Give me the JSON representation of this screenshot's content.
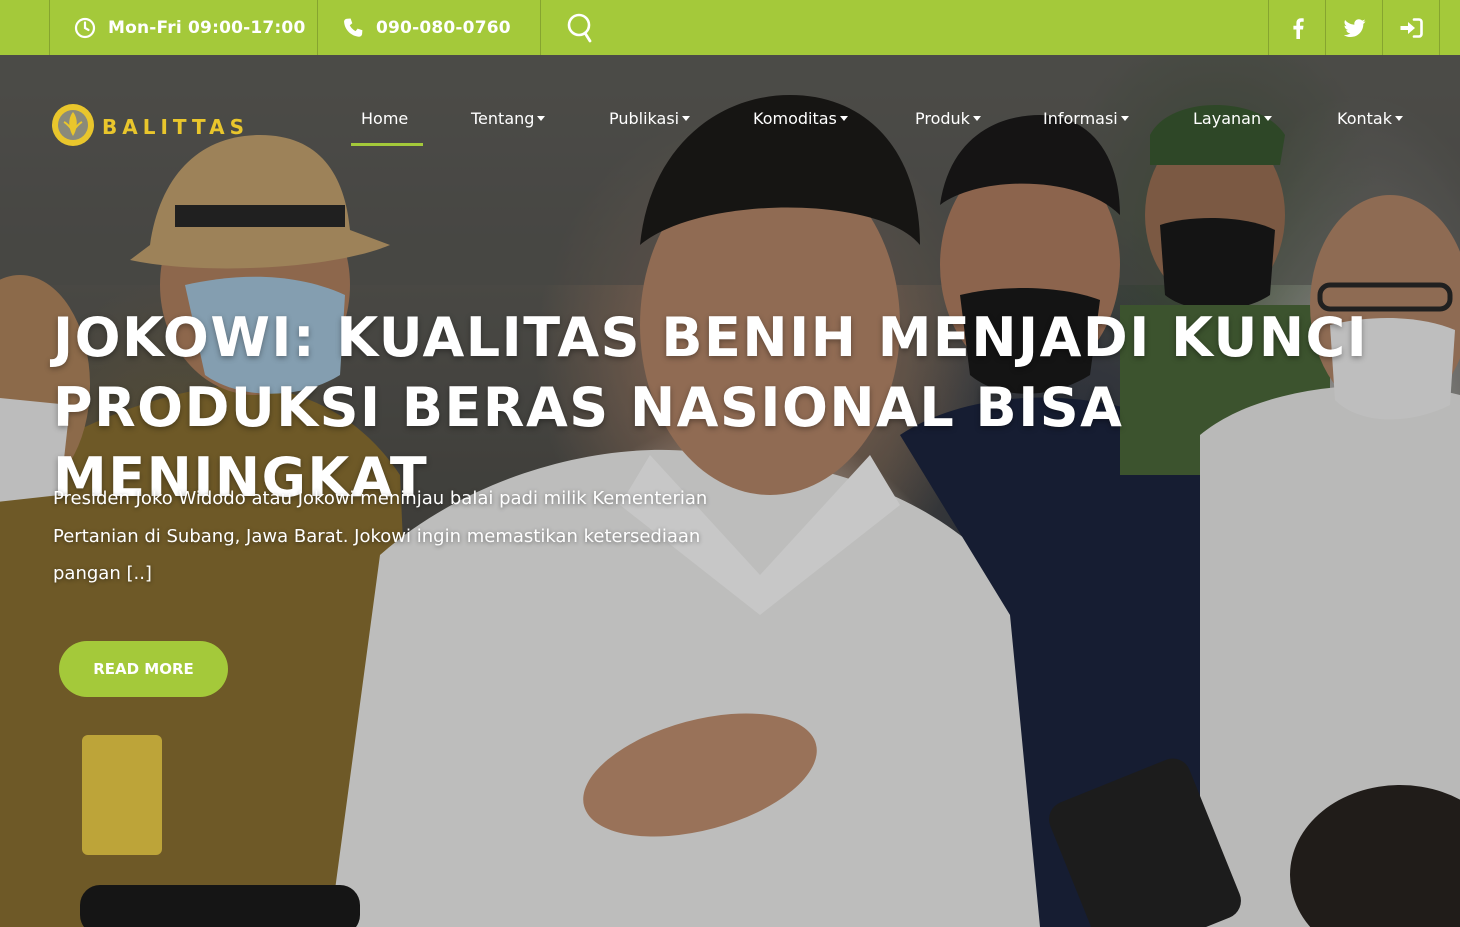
{
  "topbar": {
    "hours": "Mon-Fri 09:00-17:00",
    "phone": "090-080-0760",
    "icons": {
      "hours": "clock-icon",
      "phone": "phone-icon",
      "search": "search-icon",
      "facebook": "facebook-icon",
      "twitter": "twitter-icon",
      "login": "sign-in-icon"
    }
  },
  "brand": {
    "name": "BALITTAS"
  },
  "nav": {
    "items": [
      {
        "label": "Home",
        "dropdown": false,
        "active": true
      },
      {
        "label": "Tentang",
        "dropdown": true
      },
      {
        "label": "Publikasi",
        "dropdown": true
      },
      {
        "label": "Komoditas",
        "dropdown": true
      },
      {
        "label": "Produk",
        "dropdown": true
      },
      {
        "label": "Informasi",
        "dropdown": true
      },
      {
        "label": "Layanan",
        "dropdown": true
      },
      {
        "label": "Kontak",
        "dropdown": true
      }
    ]
  },
  "hero": {
    "headline_line1": "JOKOWI: KUALITAS BENIH MENJADI KUNCI",
    "headline_line2": "PRODUKSI BERAS NASIONAL BISA MENINGKAT",
    "excerpt_line1": "Presiden Joko Widodo atau Jokowi meninjau balai padi milik Kementerian",
    "excerpt_line2": "Pertanian di Subang, Jawa Barat. Jokowi ingin memastikan ketersediaan",
    "excerpt_line3": "pangan [..]",
    "button": "READ MORE"
  },
  "colors": {
    "accent": "#a4c93a",
    "logo": "#e9c62c",
    "text": "#ffffff"
  }
}
